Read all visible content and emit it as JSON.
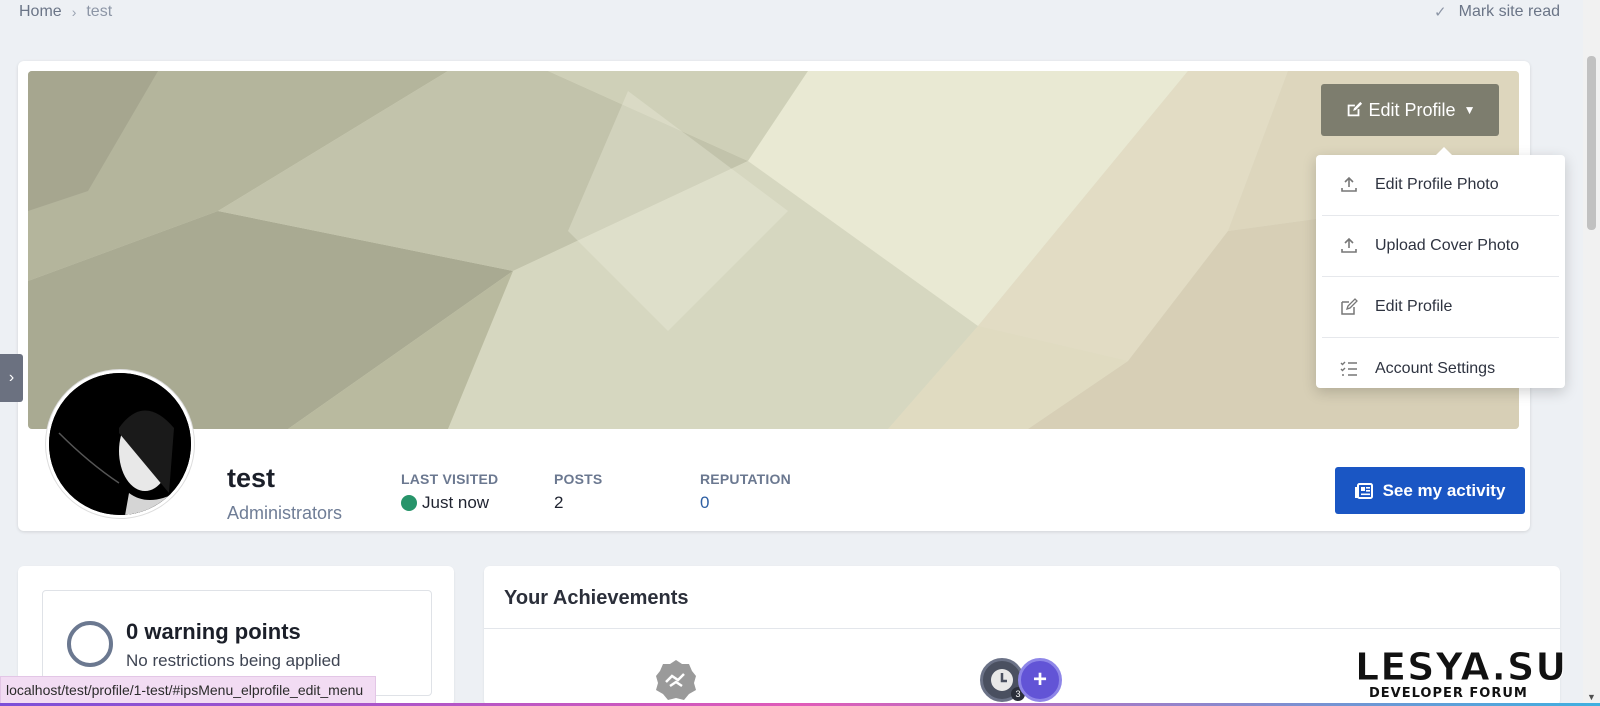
{
  "breadcrumb": {
    "home": "Home",
    "current": "test"
  },
  "header": {
    "mark_read": "Mark site read"
  },
  "profile": {
    "edit_button": "Edit Profile",
    "username": "test",
    "group": "Administrators",
    "stats": {
      "last_visited_label": "LAST VISITED",
      "last_visited_value": "Just now",
      "posts_label": "POSTS",
      "posts_value": "2",
      "reputation_label": "REPUTATION",
      "reputation_value": "0"
    },
    "activity_button": "See my activity"
  },
  "edit_menu": {
    "items": [
      {
        "label": "Edit Profile Photo",
        "icon": "upload-icon"
      },
      {
        "label": "Upload Cover Photo",
        "icon": "upload-icon"
      },
      {
        "label": "Edit Profile",
        "icon": "edit-icon"
      },
      {
        "label": "Account Settings",
        "icon": "list-check-icon"
      }
    ]
  },
  "warnings": {
    "title": "0 warning points",
    "subtitle": "No restrictions being applied"
  },
  "achievements": {
    "title": "Your Achievements",
    "badge_count": "3"
  },
  "status_bar": {
    "url": "localhost/test/profile/1-test/#ipsMenu_elprofile_edit_menu"
  },
  "watermark": {
    "line1": "LESYA.SU",
    "line2": "DEVELOPER FORUM"
  },
  "colors": {
    "primary": "#1a56c4",
    "online": "#27946a",
    "edit_button": "#7d7d6e"
  }
}
